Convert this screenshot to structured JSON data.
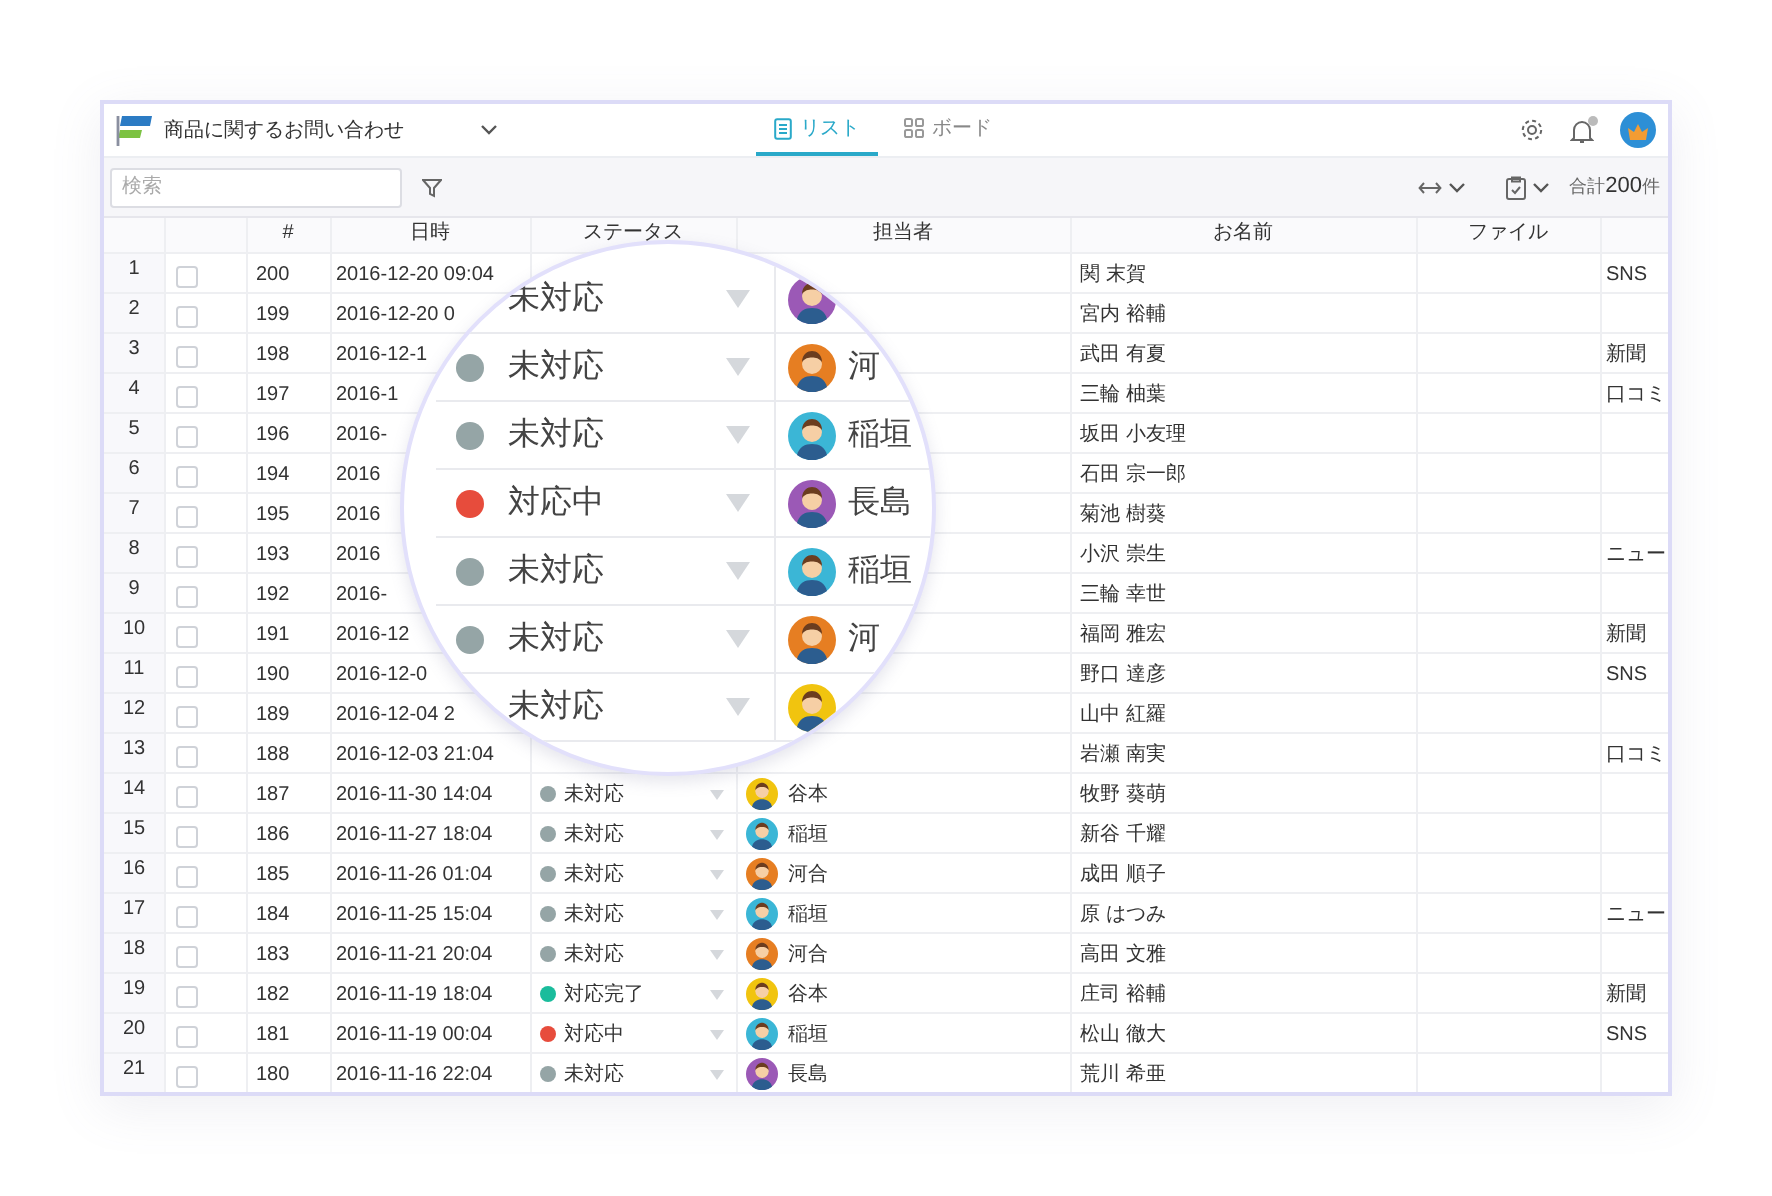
{
  "header": {
    "title": "商品に関するお問い合わせ",
    "tabs": [
      {
        "label": "リスト",
        "kind": "list",
        "selected": true
      },
      {
        "label": "ボード",
        "kind": "board",
        "selected": false
      }
    ],
    "notification_dot": true
  },
  "toolbar": {
    "search": {
      "placeholder": "検索"
    },
    "total": "合計**200**件"
  },
  "table": {
    "columns": [
      "#",
      "日時",
      "ステータス",
      "担当者",
      "お名前",
      "ファイル"
    ],
    "rows": [
      {
        "index": "1",
        "checked": false,
        "number": "200",
        "datetime": "2016-12-20 09:04",
        "name": "関 末賀",
        "column_9": "SNS"
      },
      {
        "index": "2",
        "checked": false,
        "number": "199",
        "datetime": "2016-12-20 0",
        "name": "宮内 裕輔"
      },
      {
        "index": "3",
        "checked": false,
        "number": "198",
        "datetime": "2016-12-1",
        "name": "武田 有夏",
        "column_9": "新聞"
      },
      {
        "index": "4",
        "checked": false,
        "number": "197",
        "datetime": "2016-1",
        "name": "三輪 柚葉",
        "column_9": "口コミ"
      },
      {
        "index": "5",
        "checked": false,
        "number": "196",
        "datetime": "2016-",
        "name": "坂田 小友理"
      },
      {
        "index": "6",
        "checked": false,
        "number": "194",
        "datetime": "2016",
        "name": "石田 宗一郎"
      },
      {
        "index": "7",
        "checked": false,
        "number": "195",
        "datetime": "2016",
        "name": "菊池 樹葵"
      },
      {
        "index": "8",
        "checked": false,
        "number": "193",
        "datetime": "2016",
        "name": "小沢 崇生",
        "column_9": "ニュー"
      },
      {
        "index": "9",
        "checked": false,
        "number": "192",
        "datetime": "2016-",
        "name": "三輪 幸世"
      },
      {
        "index": "10",
        "checked": false,
        "number": "191",
        "datetime": "2016-12",
        "name": "福岡 雅宏",
        "column_9": "新聞"
      },
      {
        "index": "11",
        "checked": false,
        "number": "190",
        "datetime": "2016-12-0",
        "name": "野口 達彦",
        "column_9": "SNS"
      },
      {
        "index": "12",
        "checked": false,
        "number": "189",
        "datetime": "2016-12-04 2",
        "name": "山中 紅羅"
      },
      {
        "index": "13",
        "checked": false,
        "number": "188",
        "datetime": "2016-12-03 21:04",
        "name": "岩瀬 南実",
        "column_9": "口コミ"
      },
      {
        "index": "14",
        "checked": false,
        "number": "187",
        "datetime": "2016-11-30 14:04",
        "status": {
          "label": "未対応",
          "color": "#95a5a6"
        },
        "assignee": {
          "name": "谷本",
          "color": "#f1c40f"
        },
        "name": "牧野 葵萌"
      },
      {
        "index": "15",
        "checked": false,
        "number": "186",
        "datetime": "2016-11-27 18:04",
        "status": {
          "label": "未対応",
          "color": "#95a5a6"
        },
        "assignee": {
          "name": "稲垣",
          "color": "#3bb6d6"
        },
        "name": "新谷 千耀"
      },
      {
        "index": "16",
        "checked": false,
        "number": "185",
        "datetime": "2016-11-26 01:04",
        "status": {
          "label": "未対応",
          "color": "#95a5a6"
        },
        "assignee": {
          "name": "河合",
          "color": "#e67e22"
        },
        "name": "成田 順子"
      },
      {
        "index": "17",
        "checked": false,
        "number": "184",
        "datetime": "2016-11-25 15:04",
        "status": {
          "label": "未対応",
          "color": "#95a5a6"
        },
        "assignee": {
          "name": "稲垣",
          "color": "#3bb6d6"
        },
        "name": "原 はつみ",
        "column_9": "ニュー"
      },
      {
        "index": "18",
        "checked": false,
        "number": "183",
        "datetime": "2016-11-21 20:04",
        "status": {
          "label": "未対応",
          "color": "#95a5a6"
        },
        "assignee": {
          "name": "河合",
          "color": "#e67e22"
        },
        "name": "高田 文雅"
      },
      {
        "index": "19",
        "checked": false,
        "number": "182",
        "datetime": "2016-11-19 18:04",
        "status": {
          "label": "対応完了",
          "color": "#1abc9c"
        },
        "assignee": {
          "name": "谷本",
          "color": "#f1c40f"
        },
        "name": "庄司 裕輔",
        "column_9": "新聞"
      },
      {
        "index": "20",
        "checked": false,
        "number": "181",
        "datetime": "2016-11-19 00:04",
        "status": {
          "label": "対応中",
          "color": "#e74c3c"
        },
        "assignee": {
          "name": "稲垣",
          "color": "#3bb6d6"
        },
        "name": "松山 徹大",
        "column_9": "SNS"
      },
      {
        "index": "21",
        "checked": false,
        "number": "180",
        "datetime": "2016-11-16 22:04",
        "status": {
          "label": "未対応",
          "color": "#95a5a6"
        },
        "assignee": {
          "name": "長島",
          "color": "#9b59b6"
        },
        "name": "荒川 希亜"
      }
    ]
  },
  "magnifier": {
    "rows": [
      {
        "status": {
          "label": "未対応"
        },
        "assignee": {
          "color": "#9b59b6"
        }
      },
      {
        "status": {
          "label": "未対応",
          "color": "#95a5a6"
        },
        "assignee": {
          "name": "河",
          "color": "#e67e22"
        }
      },
      {
        "status": {
          "label": "未対応",
          "color": "#95a5a6"
        },
        "assignee": {
          "name": "稲垣",
          "color": "#3bb6d6"
        }
      },
      {
        "status": {
          "label": "対応中",
          "color": "#e74c3c"
        },
        "assignee": {
          "name": "長島",
          "color": "#9b59b6"
        }
      },
      {
        "status": {
          "label": "未対応",
          "color": "#95a5a6"
        },
        "assignee": {
          "name": "稲垣",
          "color": "#3bb6d6"
        }
      },
      {
        "status": {
          "label": "未対応",
          "color": "#95a5a6"
        },
        "assignee": {
          "name": "河",
          "color": "#e67e22"
        }
      },
      {
        "status": {
          "label": "未対応"
        },
        "assignee": {
          "color": "#f1c40f"
        }
      }
    ]
  }
}
